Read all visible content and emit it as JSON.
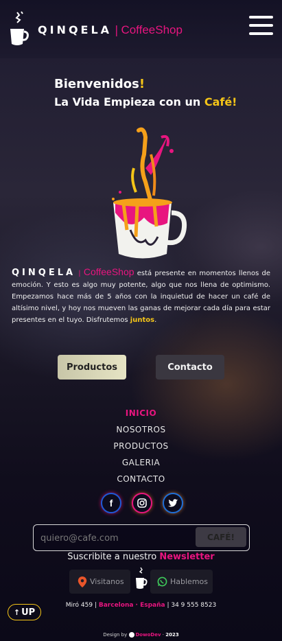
{
  "header": {
    "brand_name": "QINQELA",
    "brand_sep": "|",
    "brand_shop": "CoffeeShop",
    "menu_icon": "hamburger-icon"
  },
  "hero": {
    "welcome": "Bienvenidos",
    "welcome_excl": "!",
    "tagline_prefix": "La Vida Empieza con un ",
    "tagline_highlight": "Café!"
  },
  "about": {
    "brand_name": "QINQELA",
    "brand_sep": "|",
    "brand_shop": "CoffeeShop",
    "text": " está presente en momentos llenos de emoción. Y esto es algo muy potente, algo que nos llena de optimismo. Empezamos hace más de 5 años con la inquietud de hacer un café de altísimo nivel, y hoy nos mueven las ganas de mejorar cada día para estar presentes en el tuyo. Disfrutemos ",
    "highlight": "juntos",
    "end": "."
  },
  "buttons": {
    "productos": "Productos",
    "contacto": "Contacto"
  },
  "nav": {
    "items": [
      "INICIO",
      "NOSOTROS",
      "PRODUCTOS",
      "GALERIA",
      "CONTACTO"
    ]
  },
  "social": {
    "facebook": "f",
    "instagram": "instagram-icon",
    "twitter": "twitter-icon"
  },
  "newsletter": {
    "placeholder": "quiero@cafe.com",
    "button": "CAFÉ!",
    "text_prefix": "Suscribite a nuestro ",
    "text_highlight": "Newsletter"
  },
  "contact_pills": {
    "visit": "Visitanos",
    "talk": "Hablemos"
  },
  "up_button": "UP",
  "footer": {
    "address_prefix": "Miró 459 | ",
    "address_city": "Barcelona · España",
    "address_phone": " | 34 9 555 8523",
    "design_prefix": "Design by ",
    "design_author": "DowoDev",
    "design_sep": " · ",
    "design_year": "2023"
  },
  "colors": {
    "accent_pink": "#e8157f",
    "accent_yellow": "#f5c518"
  }
}
